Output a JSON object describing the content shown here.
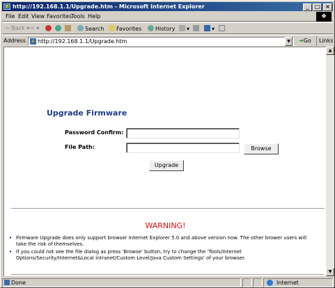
{
  "window": {
    "title": "http://192.168.1.1/Upgrade.htm - Microsoft Internet Explorer",
    "controls": {
      "minimize": "_",
      "maximize": "□",
      "close": "×"
    }
  },
  "menu": [
    "File",
    "Edit",
    "View",
    "Favorites",
    "Tools",
    "Help"
  ],
  "toolbar": {
    "back": "Back",
    "search": "Search",
    "favorites": "Favorites",
    "history": "History"
  },
  "address": {
    "label": "Address",
    "url": "http://192.168.1.1/Upgrade.htm",
    "go": "Go",
    "links": "Links"
  },
  "page": {
    "title": "Upgrade Firmware",
    "password_label": "Password Confirm:",
    "password_value": "",
    "path_label": "File Path:",
    "path_value": "",
    "browse_label": "Browse",
    "upgrade_label": "Upgrade",
    "warning_title": "WARNING!",
    "notes": [
      "Firmware Upgrade does only support browser Internet Explorer 5.0 and above version now. The other brower users will take the risk of themselves.",
      "If you could not see the file dialog as press 'Browse' button, try to change the 'Tools/Internet Options/Security/Internet&Local intranet/Custom Level/Java Custom Settings' of your browser."
    ]
  },
  "status": {
    "text": "Done",
    "zone": "Internet"
  },
  "colors": {
    "title_accent": "#1f3c88",
    "warning": "#dd1111",
    "titlebar": "#0a246a"
  }
}
